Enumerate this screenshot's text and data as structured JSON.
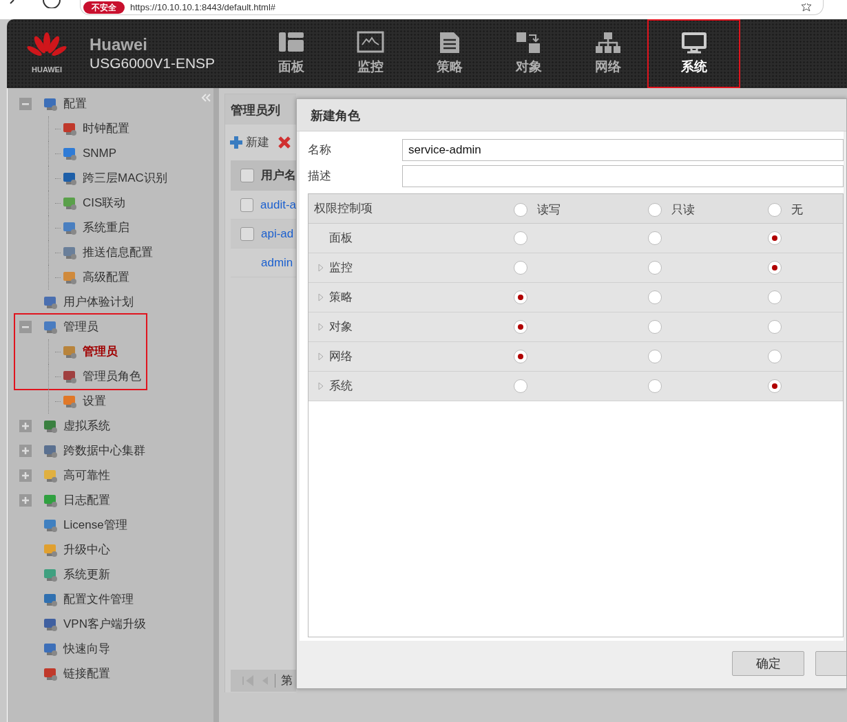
{
  "browser": {
    "security_badge": "不安全",
    "url": "https://10.10.10.1:8443/default.html#"
  },
  "header": {
    "logo_text": "HUAWEI",
    "brand": "Huawei",
    "device": "USG6000V1-ENSP",
    "nav": [
      {
        "label": "面板",
        "selected": false,
        "highlighted": false
      },
      {
        "label": "监控",
        "selected": false,
        "highlighted": false
      },
      {
        "label": "策略",
        "selected": false,
        "highlighted": false
      },
      {
        "label": "对象",
        "selected": false,
        "highlighted": false
      },
      {
        "label": "网络",
        "selected": false,
        "highlighted": false
      },
      {
        "label": "系统",
        "selected": true,
        "highlighted": true
      }
    ]
  },
  "sidebar": {
    "items": [
      {
        "label": "配置",
        "expanded": true,
        "selected": false,
        "children": [
          {
            "label": "时钟配置",
            "selected": false
          },
          {
            "label": "SNMP",
            "selected": false
          },
          {
            "label": "跨三层MAC识别",
            "selected": false
          },
          {
            "label": "CIS联动",
            "selected": false
          },
          {
            "label": "系统重启",
            "selected": false
          },
          {
            "label": "推送信息配置",
            "selected": false
          },
          {
            "label": "高级配置",
            "selected": false
          }
        ]
      },
      {
        "label": "用户体验计划",
        "selected": false
      },
      {
        "label": "管理员",
        "expanded": true,
        "selected": false,
        "highlighted": true,
        "children": [
          {
            "label": "管理员",
            "selected": true,
            "highlighted": true
          },
          {
            "label": "管理员角色",
            "selected": false,
            "highlighted": true
          },
          {
            "label": "设置",
            "selected": false
          }
        ]
      },
      {
        "label": "虚拟系统",
        "expanded": false,
        "selected": false
      },
      {
        "label": "跨数据中心集群",
        "expanded": false,
        "selected": false
      },
      {
        "label": "高可靠性",
        "expanded": false,
        "selected": false
      },
      {
        "label": "日志配置",
        "expanded": false,
        "selected": false
      },
      {
        "label": "License管理",
        "selected": false
      },
      {
        "label": "升级中心",
        "selected": false
      },
      {
        "label": "系统更新",
        "selected": false
      },
      {
        "label": "配置文件管理",
        "selected": false
      },
      {
        "label": "VPN客户端升级",
        "selected": false
      },
      {
        "label": "快速向导",
        "selected": false
      },
      {
        "label": "链接配置",
        "selected": false
      }
    ]
  },
  "admin_list": {
    "title": "管理员列",
    "toolbar": [
      {
        "kind": "add",
        "label": "新建"
      },
      {
        "kind": "delete"
      }
    ],
    "column": {
      "label": "用户名",
      "checked": false
    },
    "rows": [
      {
        "name": "audit-a",
        "checked": false
      },
      {
        "name": "api-ad",
        "checked": false
      },
      {
        "name": "admin"
      }
    ],
    "pager": {
      "label": "第"
    }
  },
  "dialog": {
    "title": "新建角色",
    "fields": [
      {
        "label": "名称",
        "value": "service-admin"
      },
      {
        "label": "描述"
      }
    ],
    "permissions": {
      "header": "权限控制项",
      "columns": [
        {
          "label": "读写",
          "selected": false
        },
        {
          "label": "只读",
          "selected": false
        },
        {
          "label": "无",
          "selected": false
        }
      ],
      "rows": [
        {
          "label": "面板",
          "expandable": false,
          "options": [
            {
              "selected": false
            },
            {
              "selected": false
            },
            {
              "selected": true
            }
          ]
        },
        {
          "label": "监控",
          "expandable": true,
          "options": [
            {
              "selected": false
            },
            {
              "selected": false
            },
            {
              "selected": true
            }
          ]
        },
        {
          "label": "策略",
          "expandable": true,
          "options": [
            {
              "selected": true
            },
            {
              "selected": false
            },
            {
              "selected": false
            }
          ]
        },
        {
          "label": "对象",
          "expandable": true,
          "options": [
            {
              "selected": true
            },
            {
              "selected": false
            },
            {
              "selected": false
            }
          ]
        },
        {
          "label": "网络",
          "expandable": true,
          "options": [
            {
              "selected": true
            },
            {
              "selected": false
            },
            {
              "selected": false
            }
          ]
        },
        {
          "label": "系统",
          "expandable": true,
          "options": [
            {
              "selected": false
            },
            {
              "selected": false
            },
            {
              "selected": true
            }
          ]
        }
      ]
    },
    "buttons": [
      "确定"
    ]
  }
}
